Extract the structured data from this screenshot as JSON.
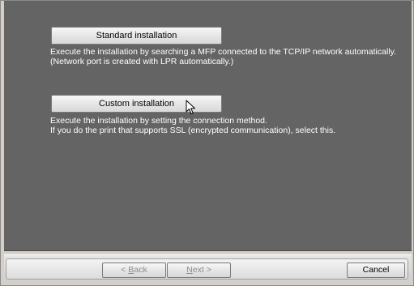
{
  "options": {
    "standard": {
      "button_label": "Standard installation",
      "description_line1": "Execute the installation by searching a MFP connected to the TCP/IP network automatically.",
      "description_line2": "(Network port is created with LPR automatically.)"
    },
    "custom": {
      "button_label": "Custom installation",
      "description_line1": "Execute the installation by setting the connection method.",
      "description_line2": "If you do the print that supports SSL (encrypted communication), select this."
    }
  },
  "footer": {
    "back_prefix": "< ",
    "back_mnemonic": "B",
    "back_rest": "ack",
    "next_mnemonic": "N",
    "next_rest": "ext >",
    "cancel_label": "Cancel"
  },
  "colors": {
    "content_background": "#646464",
    "description_text": "#ffffff",
    "disabled_button_text": "#8c8c8c"
  },
  "icons": {
    "cursor": "mouse-pointer-icon"
  }
}
